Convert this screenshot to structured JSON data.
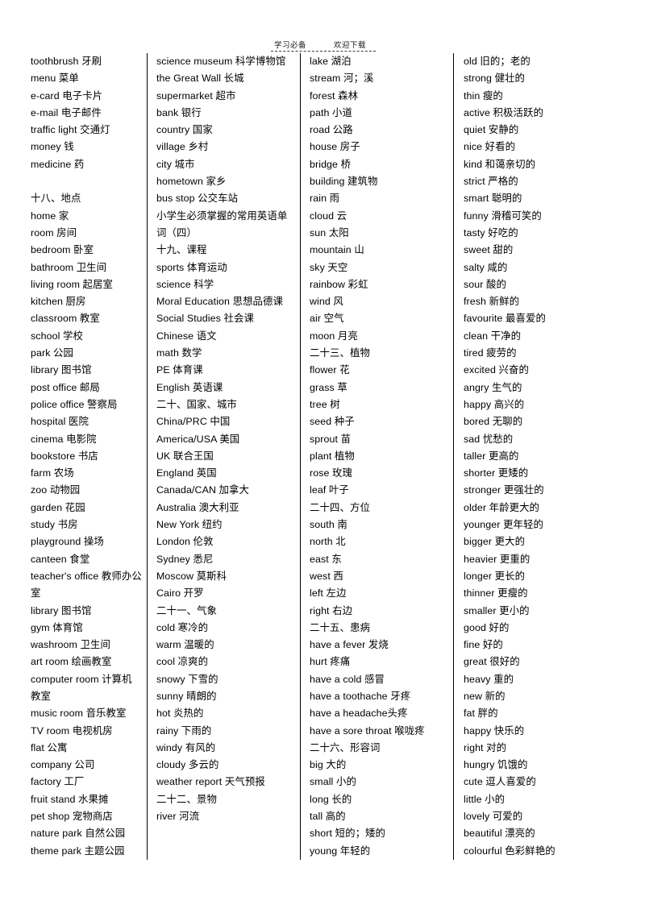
{
  "watermark": {
    "left_text": "学习必备",
    "right_text": "欢迎下载"
  },
  "document": {
    "title": "小学生必须掌握的常用英语单词（四）"
  },
  "columns": [
    {
      "id": "column-1",
      "entries": [
        "toothbrush  牙刷",
        "menu 菜单",
        "e-card 电子卡片",
        "e-mail 电子邮件",
        "traffic light  交通灯",
        "money 钱",
        "medicine  药",
        "",
        "十八、地点",
        "home 家",
        "room 房间",
        "bedroom 卧室",
        "bathroom  卫生间",
        "living room   起居室",
        "kitchen  厨房",
        "classroom 教室",
        "school 学校",
        "park 公园",
        "library  图书馆",
        "post office  邮局",
        "police office   警察局",
        "hospital 医院",
        "cinema 电影院",
        "bookstore 书店",
        "farm 农场",
        "zoo 动物园",
        "garden 花园",
        "study 书房",
        "playground  操场",
        "canteen 食堂",
        "teacher's office   教师办公室",
        "library  图书馆",
        "gym 体育馆",
        "washroom 卫生间",
        "art room  绘画教室",
        "computer  room 计算机教室",
        "music room  音乐教室",
        "TV room  电视机房",
        "flat  公寓",
        "company  公司",
        "factory  工厂",
        "fruit stand  水果摊",
        "pet shop 宠物商店",
        "nature park 自然公园",
        "theme park 主题公园"
      ]
    },
    {
      "id": "column-2",
      "entries": [
        "science museum 科学博物馆",
        "the Great Wall  长城",
        "supermarket 超市",
        "bank 银行",
        "country  国家",
        "village  乡村",
        "city  城市",
        "hometown  家乡",
        "bus stop 公交车站",
        "小学生必须掌握的常用英语单词（四）",
        "十九、课程",
        "sports 体育运动",
        "science 科学",
        "Moral Education  思想品德课",
        "Social Studies  社会课",
        "Chinese 语文",
        "math 数学",
        "PE 体育课",
        "English 英语课",
        "二十、国家、城市",
        "China/PRC 中国",
        "America/USA  美国",
        "UK  联合王国",
        "England 英国",
        "Canada/CAN 加拿大",
        "Australia  澳大利亚",
        "New York  纽约",
        "London  伦敦",
        "Sydney 悉尼",
        "Moscow  莫斯科",
        "Cairo  开罗",
        "二十一、气象",
        "cold 寒冷的",
        "warm  温暖的",
        "cool  凉爽的",
        "snowy  下雪的",
        "sunny  晴朗的",
        "hot  炎热的",
        "rainy  下雨的",
        "windy  有风的",
        "cloudy  多云的",
        "weather report 天气预报",
        "二十二、景物",
        "river  河流"
      ]
    },
    {
      "id": "column-3",
      "entries": [
        "lake 湖泊",
        "stream 河；溪",
        "forest 森林",
        "path 小道",
        "road 公路",
        "house 房子",
        "bridge 桥",
        "building  建筑物",
        "rain 雨",
        "cloud 云",
        "sun 太阳",
        "mountain  山",
        "sky 天空",
        "rainbow 彩虹",
        "wind  风",
        "air  空气",
        "moon 月亮",
        "二十三、植物",
        "flower  花",
        "grass 草",
        "tree 树",
        "seed 种子",
        "sprout 苗",
        "plant 植物",
        "rose 玫瑰",
        "leaf 叶子",
        "二十四、方位",
        "south 南",
        "north 北",
        "east 东",
        "west 西",
        "left  左边",
        "right  右边",
        "二十五、患病",
        "have a fever 发烧",
        "hurt 疼痛",
        "have a cold 感冒",
        "have a toothache 牙疼",
        "have a headache头疼",
        "have a sore throat 喉咙疼",
        "二十六、形容词",
        "big 大的",
        "small 小的",
        "long 长的",
        "tall 高的",
        "short 短的；矮的",
        "young 年轻的"
      ]
    },
    {
      "id": "column-4",
      "entries": [
        "old 旧的；老的",
        "strong 健壮的",
        "thin 瘦的",
        "active 积极活跃的",
        "quiet 安静的",
        "nice 好看的",
        "kind  和蔼亲切的",
        "strict  严格的",
        "smart 聪明的",
        "funny  滑稽可笑的",
        "tasty 好吃的",
        "sweet 甜的",
        "salty 咸的",
        "sour 酸的",
        "fresh 新鲜的",
        "favourite  最喜爱的",
        "clean 干净的",
        "tired 疲劳的",
        "excited 兴奋的",
        "angry 生气的",
        "happy 高兴的",
        "bored 无聊的",
        "sad 忧愁的",
        "taller 更高的",
        "shorter 更矮的",
        "stronger 更强壮的",
        "older 年龄更大的",
        "younger 更年轻的",
        "bigger 更大的",
        "heavier 更重的",
        "longer 更长的",
        "thinner 更瘦的",
        "smaller 更小的",
        "good 好的",
        "fine 好的",
        "great 很好的",
        "heavy  重的",
        "new 新的",
        "fat 胖的",
        "happy 快乐的",
        "right 对的",
        "hungry 饥饿的",
        "cute 逗人喜爱的",
        "little 小的",
        "lovely  可爱的",
        "beautiful  漂亮的",
        "colourful  色彩鲜艳的"
      ]
    }
  ]
}
